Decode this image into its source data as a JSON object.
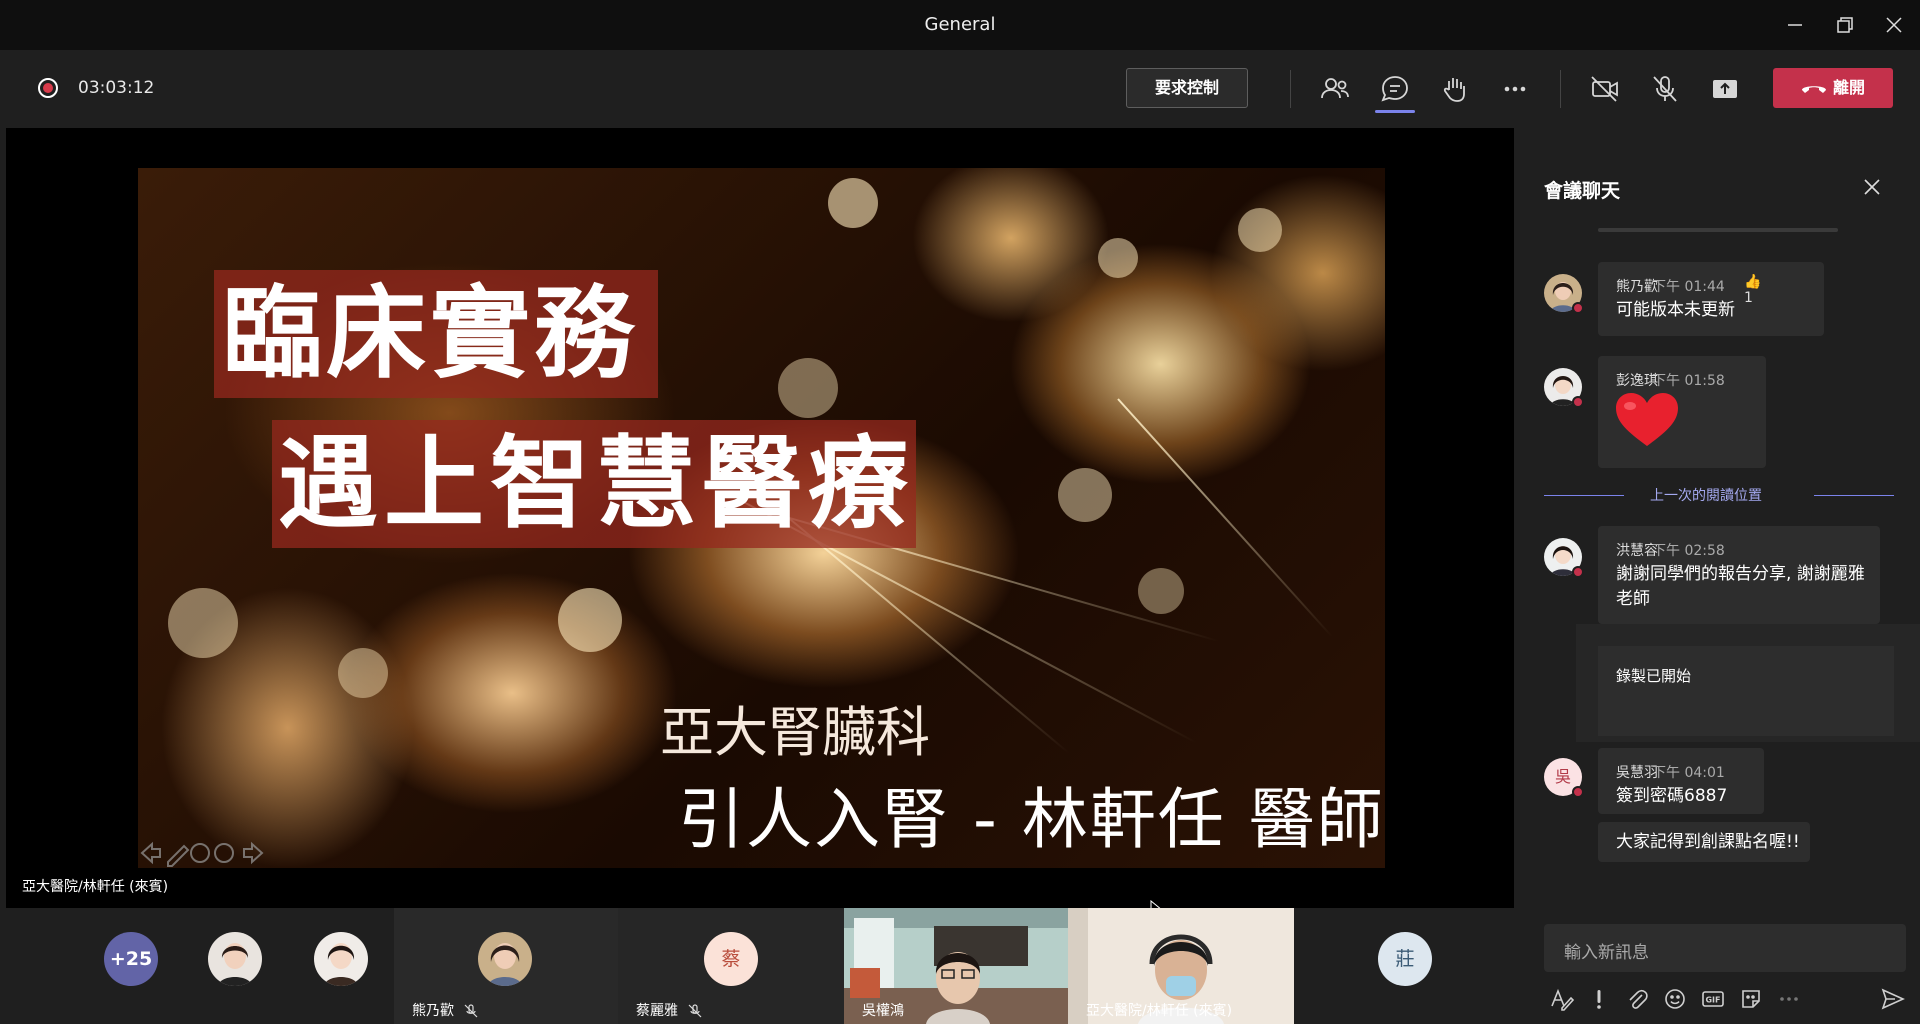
{
  "window": {
    "title": "General"
  },
  "toolbar": {
    "timer": "03:03:12",
    "request_control_label": "要求控制",
    "leave_label": "離開",
    "colors": {
      "leave": "#c4314b",
      "accent": "#7b83eb",
      "record": "#d83b4b"
    }
  },
  "stage": {
    "slide": {
      "line1": "臨床實務",
      "line2": "遇上智慧醫療",
      "sub1": "亞大腎臟科",
      "sub2": "引人入腎 - 林軒任 醫師"
    },
    "presenter_label": "亞大醫院/林軒任 (來賓)"
  },
  "participants": {
    "more_count": "+25",
    "tiles": [
      {
        "name": "熊乃歡",
        "muted": true
      },
      {
        "name": "蔡麗雅",
        "muted": true,
        "initial": "蔡"
      },
      {
        "name": "吳權鴻"
      },
      {
        "name": "亞大醫院/林軒任 (來賓)"
      },
      {
        "initial": "莊"
      }
    ]
  },
  "chat": {
    "title": "會議聊天",
    "messages": [
      {
        "sender": "熊乃歡",
        "time": "下午 01:44",
        "text": "可能版本未更新",
        "reaction": "1"
      },
      {
        "sender": "彭逸琪",
        "time": "下午 01:58",
        "emoji": "heart"
      },
      {
        "sender": "洪慧容",
        "time": "下午 02:58",
        "text": "謝謝同學們的報告分享, 謝謝麗雅老師"
      },
      {
        "sender": "吳慧羽",
        "time": "下午 04:01",
        "text": "簽到密碼6887",
        "avatar_initial": "吳"
      },
      {
        "text": "大家記得到創課點名喔!!"
      }
    ],
    "last_read_label": "上一次的閱讀位置",
    "system_message": "錄製已開始",
    "compose_placeholder": "輸入新訊息"
  }
}
